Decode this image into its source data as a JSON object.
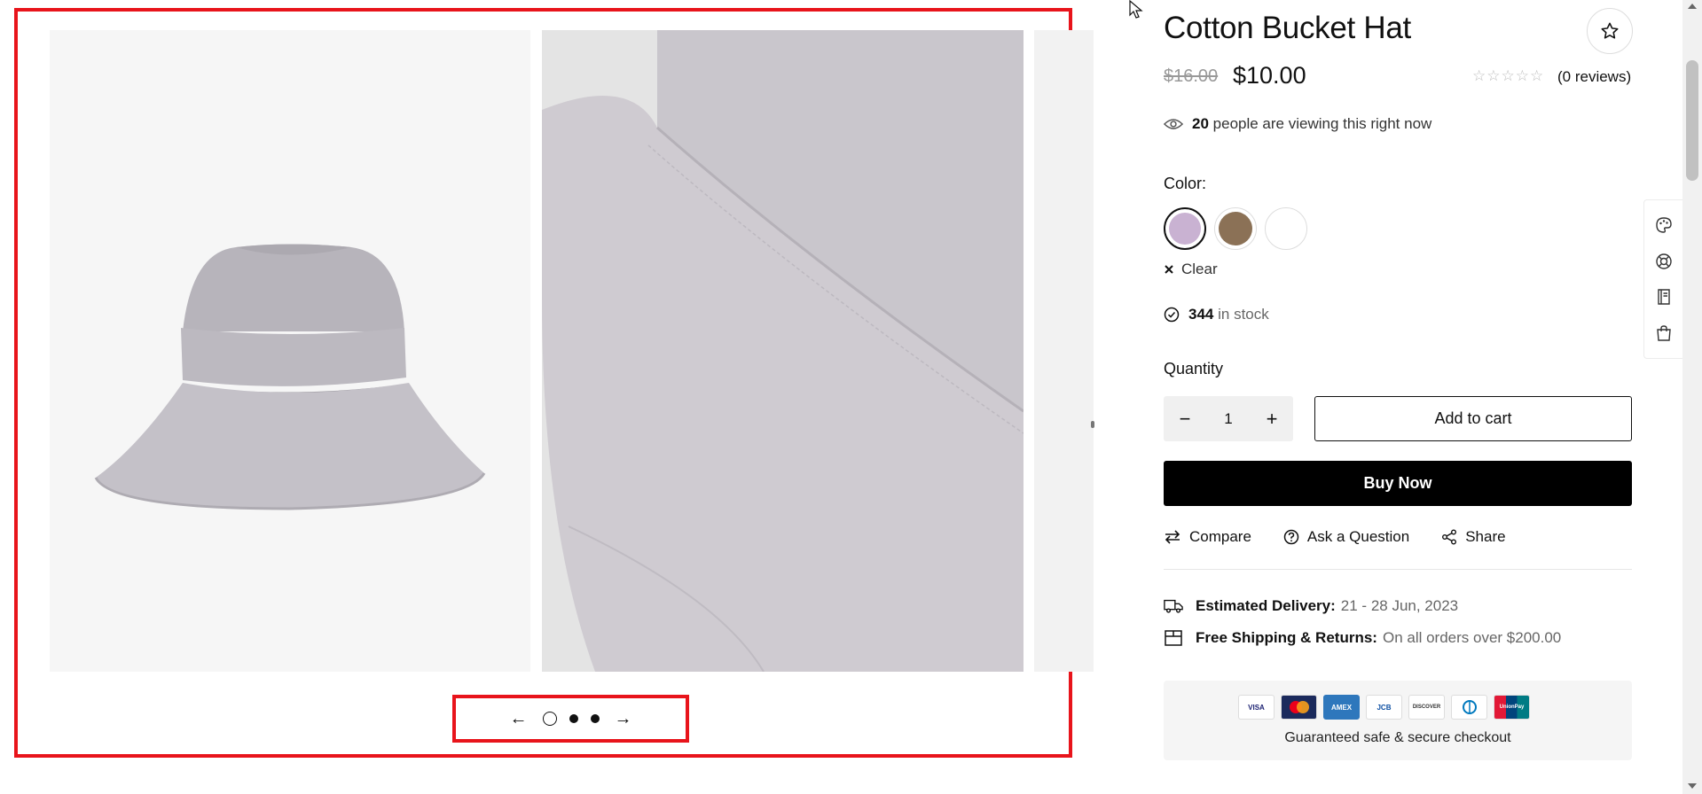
{
  "product": {
    "title": "Cotton Bucket Hat",
    "old_price": "$16.00",
    "price": "$10.00",
    "rating_stars": "☆☆☆☆☆",
    "reviews": "(0 reviews)",
    "viewing_count": "20",
    "viewing_text": "people are viewing this right now",
    "color_label": "Color:",
    "colors": [
      "#c9b2d2",
      "#8b7156",
      "#ffffff"
    ],
    "clear_label": "Clear",
    "stock_count": "344",
    "stock_text": "in stock",
    "quantity_label": "Quantity",
    "quantity_value": "1",
    "add_to_cart": "Add to cart",
    "buy_now": "Buy Now",
    "actions": {
      "compare": "Compare",
      "ask": "Ask a Question",
      "share": "Share"
    },
    "delivery_label": "Estimated Delivery:",
    "delivery_value": "21 - 28 Jun, 2023",
    "shipping_label": "Free Shipping & Returns:",
    "shipping_value": "On all orders over $200.00",
    "payment_cards": [
      "VISA",
      "MC",
      "AMEX",
      "JCB",
      "DISCOVER",
      "DINERS",
      "UnionPay"
    ],
    "secure_text": "Guaranteed safe & secure checkout"
  },
  "gallery": {
    "prev_icon": "←",
    "next_icon": "→"
  },
  "icons": {
    "favorite": "star-icon",
    "eye": "eye-icon",
    "clear": "close-icon",
    "stock": "check-circle-icon",
    "minus": "minus-icon",
    "plus": "plus-icon",
    "compare": "compare-arrows-icon",
    "ask": "question-circle-icon",
    "share": "share-icon",
    "delivery": "truck-icon",
    "shipping": "box-icon",
    "rail": [
      "palette-icon",
      "lifebuoy-icon",
      "book-icon",
      "shopping-bag-icon"
    ]
  },
  "colors": {
    "accent_border": "#e8141b",
    "buy_now_bg": "#000000",
    "hat_color": "#c4c1c8"
  }
}
